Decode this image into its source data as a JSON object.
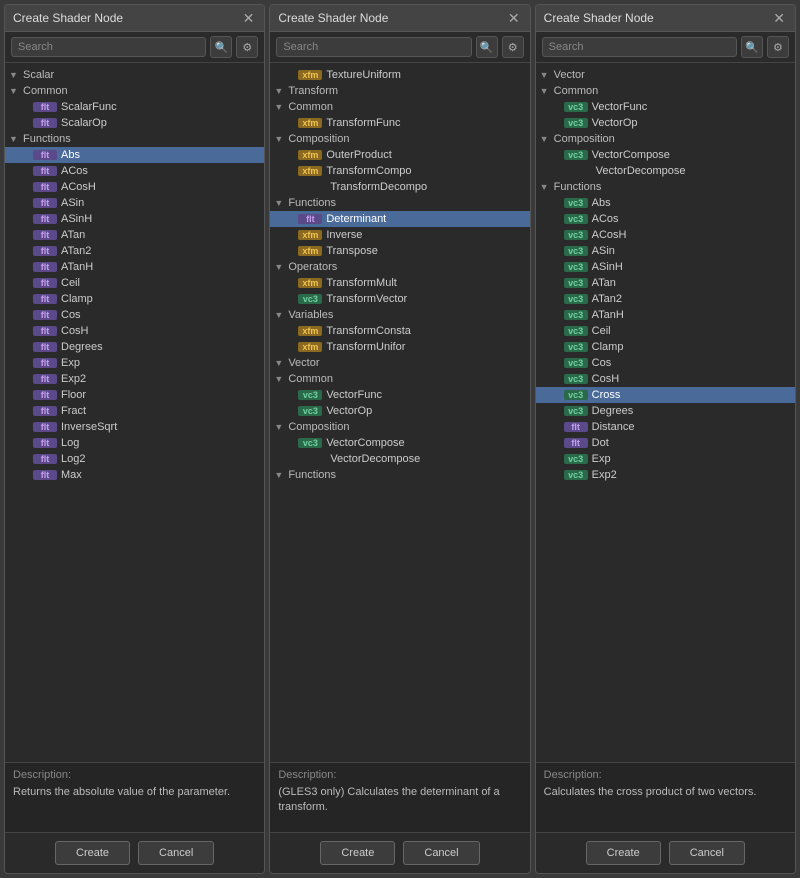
{
  "panels": [
    {
      "id": "panel1",
      "title": "Create Shader Node",
      "search_placeholder": "Search",
      "description_label": "Description:",
      "description_text": "Returns the absolute value of the parameter.",
      "create_label": "Create",
      "cancel_label": "Cancel",
      "tree": [
        {
          "type": "category",
          "level": 0,
          "label": "Scalar",
          "open": true
        },
        {
          "type": "category",
          "level": 1,
          "label": "Common",
          "open": true
        },
        {
          "type": "item",
          "level": 2,
          "badge": "flt",
          "label": "ScalarFunc"
        },
        {
          "type": "item",
          "level": 2,
          "badge": "flt",
          "label": "ScalarOp"
        },
        {
          "type": "category",
          "level": 1,
          "label": "Functions",
          "open": true
        },
        {
          "type": "item",
          "level": 2,
          "badge": "flt",
          "label": "Abs",
          "selected": true
        },
        {
          "type": "item",
          "level": 2,
          "badge": "flt",
          "label": "ACos"
        },
        {
          "type": "item",
          "level": 2,
          "badge": "flt",
          "label": "ACosH"
        },
        {
          "type": "item",
          "level": 2,
          "badge": "flt",
          "label": "ASin"
        },
        {
          "type": "item",
          "level": 2,
          "badge": "flt",
          "label": "ASinH"
        },
        {
          "type": "item",
          "level": 2,
          "badge": "flt",
          "label": "ATan"
        },
        {
          "type": "item",
          "level": 2,
          "badge": "flt",
          "label": "ATan2"
        },
        {
          "type": "item",
          "level": 2,
          "badge": "flt",
          "label": "ATanH"
        },
        {
          "type": "item",
          "level": 2,
          "badge": "flt",
          "label": "Ceil"
        },
        {
          "type": "item",
          "level": 2,
          "badge": "flt",
          "label": "Clamp"
        },
        {
          "type": "item",
          "level": 2,
          "badge": "flt",
          "label": "Cos"
        },
        {
          "type": "item",
          "level": 2,
          "badge": "flt",
          "label": "CosH"
        },
        {
          "type": "item",
          "level": 2,
          "badge": "flt",
          "label": "Degrees"
        },
        {
          "type": "item",
          "level": 2,
          "badge": "flt",
          "label": "Exp"
        },
        {
          "type": "item",
          "level": 2,
          "badge": "flt",
          "label": "Exp2"
        },
        {
          "type": "item",
          "level": 2,
          "badge": "flt",
          "label": "Floor"
        },
        {
          "type": "item",
          "level": 2,
          "badge": "flt",
          "label": "Fract"
        },
        {
          "type": "item",
          "level": 2,
          "badge": "flt",
          "label": "InverseSqrt"
        },
        {
          "type": "item",
          "level": 2,
          "badge": "flt",
          "label": "Log"
        },
        {
          "type": "item",
          "level": 2,
          "badge": "flt",
          "label": "Log2"
        },
        {
          "type": "item",
          "level": 2,
          "badge": "flt",
          "label": "Max"
        }
      ]
    },
    {
      "id": "panel2",
      "title": "Create Shader Node",
      "search_placeholder": "Search",
      "description_label": "Description:",
      "description_text": "(GLES3 only) Calculates the determinant of a transform.",
      "create_label": "Create",
      "cancel_label": "Cancel",
      "tree": [
        {
          "type": "item",
          "level": 2,
          "badge": "xfm",
          "label": "TextureUniform"
        },
        {
          "type": "category",
          "level": 0,
          "label": "Transform",
          "open": true
        },
        {
          "type": "category",
          "level": 1,
          "label": "Common",
          "open": true
        },
        {
          "type": "item",
          "level": 2,
          "badge": "xfm",
          "label": "TransformFunc"
        },
        {
          "type": "category",
          "level": 1,
          "label": "Composition",
          "open": true
        },
        {
          "type": "item",
          "level": 2,
          "badge": "xfm",
          "label": "OuterProduct"
        },
        {
          "type": "item",
          "level": 2,
          "badge": "xfm",
          "label": "TransformCompo"
        },
        {
          "type": "item",
          "level": 2,
          "badge": "none",
          "label": "TransformDecompo"
        },
        {
          "type": "category",
          "level": 1,
          "label": "Functions",
          "open": true
        },
        {
          "type": "item",
          "level": 2,
          "badge": "flt",
          "label": "Determinant",
          "selected": true
        },
        {
          "type": "item",
          "level": 2,
          "badge": "xfm",
          "label": "Inverse"
        },
        {
          "type": "item",
          "level": 2,
          "badge": "xfm",
          "label": "Transpose"
        },
        {
          "type": "category",
          "level": 1,
          "label": "Operators",
          "open": true
        },
        {
          "type": "item",
          "level": 2,
          "badge": "xfm",
          "label": "TransformMult"
        },
        {
          "type": "item",
          "level": 2,
          "badge": "vc3",
          "label": "TransformVector"
        },
        {
          "type": "category",
          "level": 1,
          "label": "Variables",
          "open": true
        },
        {
          "type": "item",
          "level": 2,
          "badge": "xfm",
          "label": "TransformConsta"
        },
        {
          "type": "item",
          "level": 2,
          "badge": "xfm",
          "label": "TransformUnifor"
        },
        {
          "type": "category",
          "level": 0,
          "label": "Vector",
          "open": true
        },
        {
          "type": "category",
          "level": 1,
          "label": "Common",
          "open": true
        },
        {
          "type": "item",
          "level": 2,
          "badge": "vc3",
          "label": "VectorFunc"
        },
        {
          "type": "item",
          "level": 2,
          "badge": "vc3",
          "label": "VectorOp"
        },
        {
          "type": "category",
          "level": 1,
          "label": "Composition",
          "open": true
        },
        {
          "type": "item",
          "level": 2,
          "badge": "vc3",
          "label": "VectorCompose"
        },
        {
          "type": "item",
          "level": 2,
          "badge": "none",
          "label": "VectorDecompose"
        },
        {
          "type": "category",
          "level": 1,
          "label": "Functions",
          "open": true
        }
      ]
    },
    {
      "id": "panel3",
      "title": "Create Shader Node",
      "search_placeholder": "Search",
      "description_label": "Description:",
      "description_text": "Calculates the cross product of two vectors.",
      "create_label": "Create",
      "cancel_label": "Cancel",
      "tree": [
        {
          "type": "category",
          "level": 0,
          "label": "Vector",
          "open": true
        },
        {
          "type": "category",
          "level": 1,
          "label": "Common",
          "open": true
        },
        {
          "type": "item",
          "level": 2,
          "badge": "vc3",
          "label": "VectorFunc"
        },
        {
          "type": "item",
          "level": 2,
          "badge": "vc3",
          "label": "VectorOp"
        },
        {
          "type": "category",
          "level": 1,
          "label": "Composition",
          "open": true
        },
        {
          "type": "item",
          "level": 2,
          "badge": "vc3",
          "label": "VectorCompose"
        },
        {
          "type": "item",
          "level": 2,
          "badge": "none",
          "label": "VectorDecompose"
        },
        {
          "type": "category",
          "level": 1,
          "label": "Functions",
          "open": true
        },
        {
          "type": "item",
          "level": 2,
          "badge": "vc3",
          "label": "Abs"
        },
        {
          "type": "item",
          "level": 2,
          "badge": "vc3",
          "label": "ACos"
        },
        {
          "type": "item",
          "level": 2,
          "badge": "vc3",
          "label": "ACosH"
        },
        {
          "type": "item",
          "level": 2,
          "badge": "vc3",
          "label": "ASin"
        },
        {
          "type": "item",
          "level": 2,
          "badge": "vc3",
          "label": "ASinH"
        },
        {
          "type": "item",
          "level": 2,
          "badge": "vc3",
          "label": "ATan"
        },
        {
          "type": "item",
          "level": 2,
          "badge": "vc3",
          "label": "ATan2"
        },
        {
          "type": "item",
          "level": 2,
          "badge": "vc3",
          "label": "ATanH"
        },
        {
          "type": "item",
          "level": 2,
          "badge": "vc3",
          "label": "Ceil"
        },
        {
          "type": "item",
          "level": 2,
          "badge": "vc3",
          "label": "Clamp"
        },
        {
          "type": "item",
          "level": 2,
          "badge": "vc3",
          "label": "Cos"
        },
        {
          "type": "item",
          "level": 2,
          "badge": "vc3",
          "label": "CosH"
        },
        {
          "type": "item",
          "level": 2,
          "badge": "vc3",
          "label": "Cross",
          "selected": true
        },
        {
          "type": "item",
          "level": 2,
          "badge": "vc3",
          "label": "Degrees"
        },
        {
          "type": "item",
          "level": 2,
          "badge": "flt",
          "label": "Distance"
        },
        {
          "type": "item",
          "level": 2,
          "badge": "flt",
          "label": "Dot"
        },
        {
          "type": "item",
          "level": 2,
          "badge": "vc3",
          "label": "Exp"
        },
        {
          "type": "item",
          "level": 2,
          "badge": "vc3",
          "label": "Exp2"
        }
      ]
    }
  ]
}
